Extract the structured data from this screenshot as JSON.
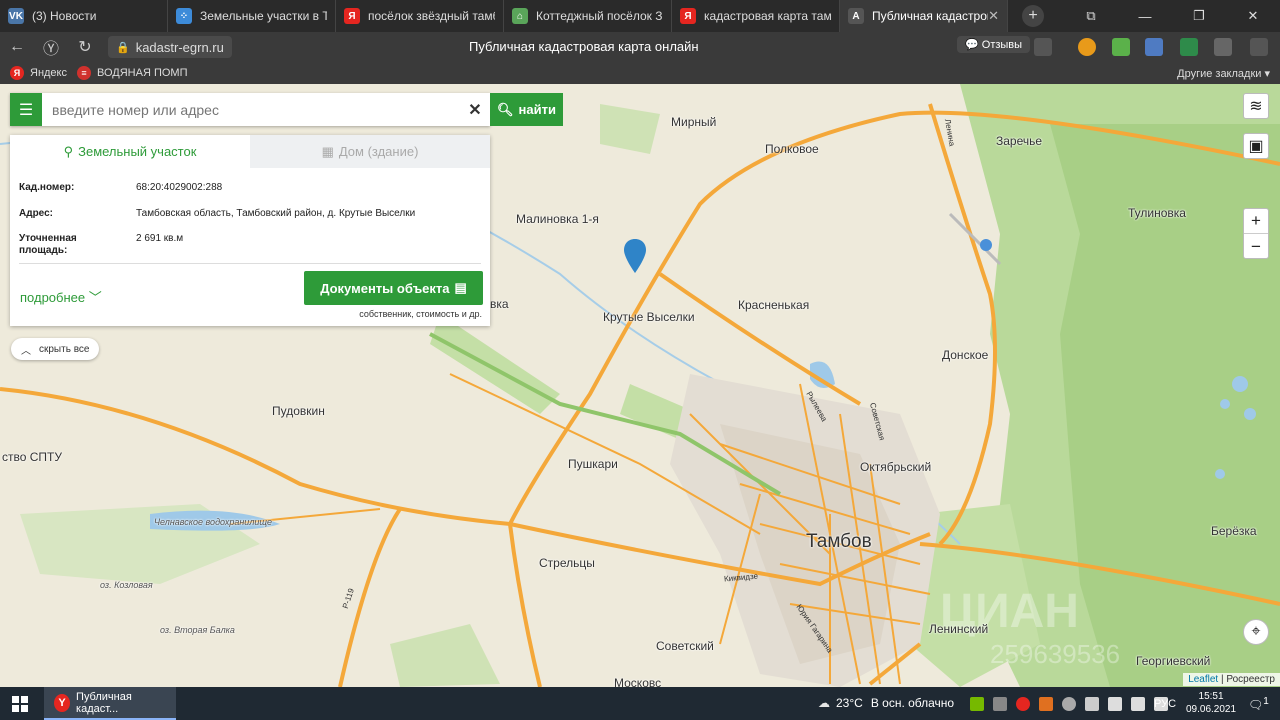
{
  "browser": {
    "tabs": [
      {
        "label": "(3) Новости",
        "icon": "vk-icon",
        "color": "#4a76a8",
        "glyph": "VK"
      },
      {
        "label": "Земельные участки в Там",
        "icon": "dots-icon",
        "color": "#3d8bd9",
        "glyph": "⁘"
      },
      {
        "label": "посёлок звёздный тамбо",
        "icon": "yandex-icon",
        "color": "#e52620",
        "glyph": "Я"
      },
      {
        "label": "Коттеджный посёлок Звё",
        "icon": "house-icon",
        "color": "#5aa55a",
        "glyph": "⌂"
      },
      {
        "label": "кадастровая карта тамбо",
        "icon": "yandex-icon",
        "color": "#e52620",
        "glyph": "Я"
      },
      {
        "label": "Публичная кадастрова",
        "icon": "map-icon",
        "color": "#555555",
        "glyph": "A",
        "active": true
      }
    ],
    "url": "kadastr-egrn.ru",
    "page_title": "Публичная кадастровая карта онлайн",
    "reviews_label": "Отзывы",
    "bookmarks": [
      {
        "label": "Яндекс",
        "color": "#e52620",
        "glyph": "Я"
      },
      {
        "label": "ВОДЯНАЯ ПОМП",
        "color": "#d0312d",
        "glyph": "≡"
      }
    ],
    "other_bookmarks": "Другие закладки"
  },
  "search": {
    "placeholder": "введите номер или адрес",
    "button_label": "найти"
  },
  "panel": {
    "tab_active": "Земельный участок",
    "tab_inactive": "Дом (здание)",
    "fields": {
      "cad_label": "Кад.номер:",
      "cad_value": "68:20:4029002:288",
      "addr_label": "Адрес:",
      "addr_value": "Тамбовская область, Тамбовский район, д. Крутые Выселки",
      "area_label": "Уточненная площадь:",
      "area_value": "2 691 кв.м"
    },
    "more_label": "подробнее",
    "docs_button": "Документы объекта",
    "docs_sub": "собственник, стоимость и др.",
    "hide_all": "скрыть все"
  },
  "map": {
    "places": {
      "mirny": "Мирный",
      "polkovoe": "Полковое",
      "zarechye": "Заречье",
      "malinovka": "Малиновка 1-я",
      "tulinovka": "Тулиновка",
      "krasnenkaya": "Красненькая",
      "krutye": "Крутые Выселки",
      "vka": "вка",
      "donskoe": "Донское",
      "pudovkin": "Пудовкин",
      "sptu": "ство СПТУ",
      "pushkari": "Пушкари",
      "oktyabrsky": "Октябрьский",
      "tambov": "Тамбов",
      "berezka": "Берёзка",
      "streltsy": "Стрельцы",
      "sovetsky": "Советский",
      "leninsky": "Ленинский",
      "georgievsky": "Георгиевский",
      "chelnav": "Челнавское водохранилище",
      "kozlovaya": "оз. Козловая",
      "vtoraya": "оз. Вторая Балка",
      "moscow": "Московс"
    },
    "streets": {
      "lenina": "Ленина",
      "rylee": "Рылеева",
      "sovetskaya": "Советская",
      "kikvidze": "Киквидзе",
      "r119": "Р-119",
      "gagarina": "Юрия Гагарина"
    },
    "attribution_leaflet": "Leaflet",
    "attribution_rosreestr": "| Росреестр",
    "watermark": "ЦИАН",
    "watermark_id": "259639536"
  },
  "taskbar": {
    "app_label": "Публичная кадаст...",
    "temperature": "23°C",
    "weather_text": "В осн. облачно",
    "lang": "РУС",
    "time": "15:51",
    "date": "09.06.2021",
    "notifications": "1"
  }
}
